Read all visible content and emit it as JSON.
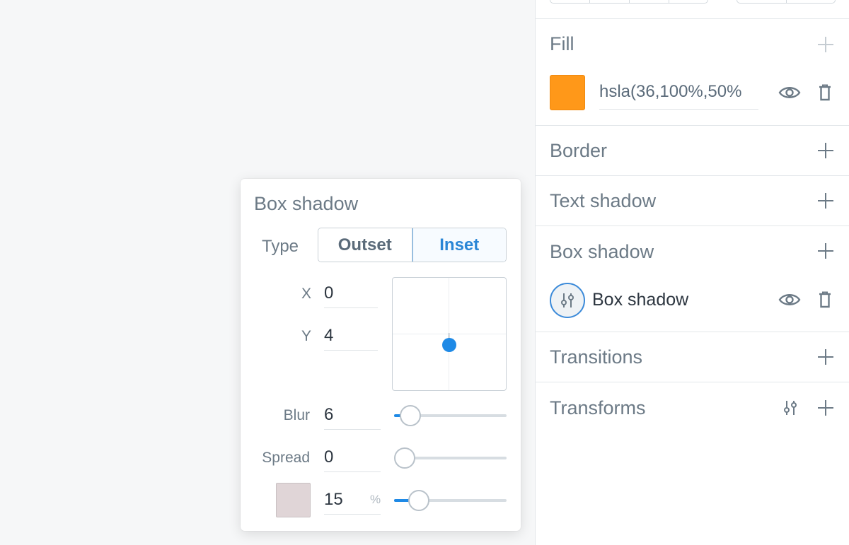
{
  "canvas": {},
  "right_panel": {
    "sections": {
      "fill": {
        "title": "Fill",
        "color_value": "hsla(36,100%,50%",
        "swatch_color": "#ff9819"
      },
      "border": {
        "title": "Border"
      },
      "text_shadow": {
        "title": "Text shadow"
      },
      "box_shadow": {
        "title": "Box shadow",
        "item_label": "Box shadow"
      },
      "transitions": {
        "title": "Transitions"
      },
      "transforms": {
        "title": "Transforms"
      }
    }
  },
  "popover": {
    "title": "Box shadow",
    "type_label": "Type",
    "type_options": [
      "Outset",
      "Inset"
    ],
    "type_selected": "Inset",
    "x_label": "X",
    "x_value": "0",
    "y_label": "Y",
    "y_value": "4",
    "blur_label": "Blur",
    "blur_value": "6",
    "spread_label": "Spread",
    "spread_value": "0",
    "opacity_value": "15",
    "opacity_unit": "%",
    "shadow_color": "#e0d5d7",
    "accent_color": "#1f8ae6"
  }
}
